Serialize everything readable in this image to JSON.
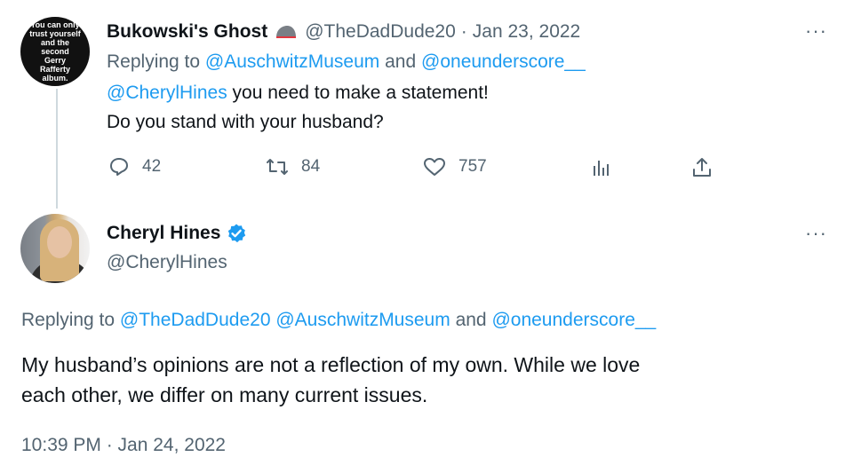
{
  "reply_tweet": {
    "avatar_text": "You can only trust yourself and the second Gerry Rafferty album.",
    "display_name": "Bukowski's Ghost",
    "handle": "@TheDadDude20",
    "separator": "·",
    "date": "Jan 23, 2022",
    "replying_prefix": "Replying to",
    "replying_to_1": "@AuschwitzMuseum",
    "replying_and": "and",
    "replying_to_2": "@oneunderscore__",
    "mention": "@CherylHines",
    "text_line1": "you need to make a statement!",
    "text_line2": "Do you stand with your husband?",
    "reply_count": "42",
    "retweet_count": "84",
    "like_count": "757",
    "more": "···"
  },
  "main_tweet": {
    "display_name": "Cheryl Hines",
    "handle": "@CherylHines",
    "verified": true,
    "replying_prefix": "Replying to",
    "replying_to_1": "@TheDadDude20",
    "replying_to_2": "@AuschwitzMuseum",
    "replying_and": "and",
    "replying_to_3": "@oneunderscore__",
    "text_line1": "My husband’s opinions are not a reflection of my own. While we love",
    "text_line2": "each other, we differ on many current issues.",
    "timestamp": "10:39 PM · Jan 24, 2022",
    "more": "···"
  },
  "colors": {
    "link": "#1d9bf0",
    "secondary": "#536471",
    "text": "#0f1419",
    "verified": "#1d9bf0"
  }
}
